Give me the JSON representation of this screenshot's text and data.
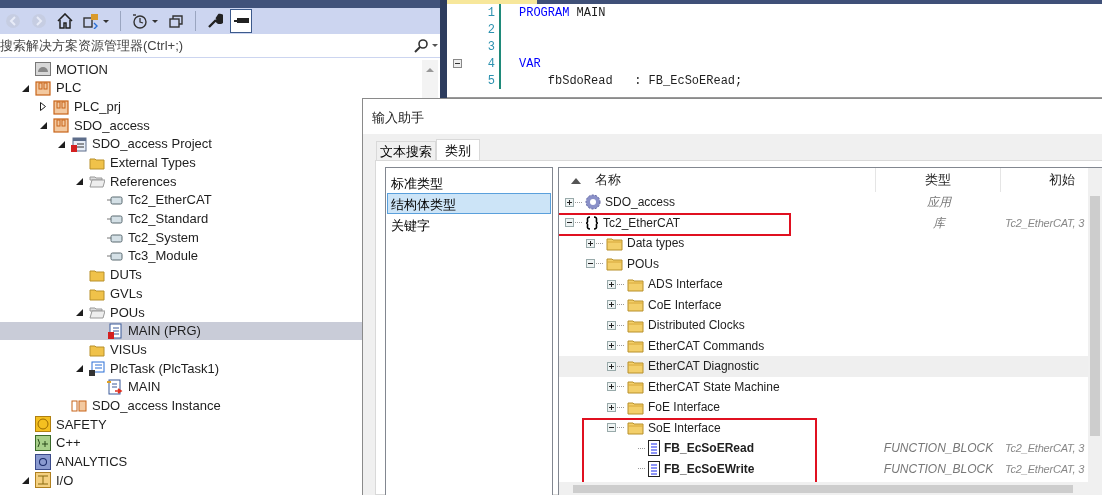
{
  "solution_explorer": {
    "toolbar": [
      {
        "kind": "back",
        "disabled": true
      },
      {
        "kind": "forward",
        "disabled": true
      },
      {
        "kind": "home",
        "disabled": false
      },
      {
        "kind": "sync",
        "disabled": false
      },
      {
        "kind": "history",
        "disabled": false
      },
      {
        "kind": "windows",
        "disabled": false
      },
      {
        "kind": "wrench",
        "disabled": false
      },
      {
        "kind": "pin",
        "disabled": false
      }
    ],
    "search": {
      "placeholder": "搜索解决方案资源管理器(Ctrl+;)"
    },
    "tree": [
      {
        "label": "MOTION",
        "kind": "motion",
        "selected": false
      },
      {
        "label": "PLC",
        "kind": "plc",
        "expanded": true,
        "selected": false,
        "children": [
          {
            "label": "PLC_prj",
            "kind": "plc",
            "expanded": false,
            "selected": false
          },
          {
            "label": "SDO_access",
            "kind": "plc",
            "expanded": true,
            "selected": false,
            "children": [
              {
                "label": "SDO_access Project",
                "kind": "project",
                "expanded": true,
                "selected": false,
                "children": [
                  {
                    "label": "External Types",
                    "kind": "folder",
                    "selected": false
                  },
                  {
                    "label": "References",
                    "kind": "references",
                    "expanded": true,
                    "selected": false,
                    "children": [
                      {
                        "label": "Tc2_EtherCAT",
                        "kind": "reference",
                        "selected": false
                      },
                      {
                        "label": "Tc2_Standard",
                        "kind": "reference",
                        "selected": false
                      },
                      {
                        "label": "Tc2_System",
                        "kind": "reference",
                        "selected": false
                      },
                      {
                        "label": "Tc3_Module",
                        "kind": "reference",
                        "selected": false
                      }
                    ]
                  },
                  {
                    "label": "DUTs",
                    "kind": "folder",
                    "selected": false
                  },
                  {
                    "label": "GVLs",
                    "kind": "folder",
                    "selected": false
                  },
                  {
                    "label": "POUs",
                    "kind": "references",
                    "expanded": true,
                    "selected": false,
                    "children": [
                      {
                        "label": "MAIN (PRG)",
                        "kind": "program",
                        "selected": true
                      }
                    ]
                  },
                  {
                    "label": "VISUs",
                    "kind": "folder",
                    "selected": false
                  },
                  {
                    "label": "PlcTask (PlcTask1)",
                    "kind": "task",
                    "expanded": true,
                    "selected": false,
                    "children": [
                      {
                        "label": "MAIN",
                        "kind": "call",
                        "selected": false
                      }
                    ]
                  }
                ]
              },
              {
                "label": "SDO_access Instance",
                "kind": "instance",
                "selected": false
              }
            ]
          }
        ]
      },
      {
        "label": "SAFETY",
        "kind": "safety",
        "selected": false
      },
      {
        "label": "C++",
        "kind": "cpp",
        "selected": false
      },
      {
        "label": "ANALYTICS",
        "kind": "analytics",
        "selected": false
      },
      {
        "label": "I/O",
        "kind": "io",
        "expanded": true,
        "selected": false
      }
    ]
  },
  "editor": {
    "lines": [
      {
        "number": "1",
        "fold": false,
        "segments": [
          {
            "text": "PROGRAM",
            "kind": "keyword"
          },
          {
            "text": " MAIN",
            "kind": "plain"
          }
        ]
      },
      {
        "number": "2",
        "fold": false
      },
      {
        "number": "3",
        "fold": false
      },
      {
        "number": "4",
        "fold": true,
        "segments": [
          {
            "text": "VAR",
            "kind": "keyword"
          }
        ]
      },
      {
        "number": "5",
        "fold": false,
        "segments": [
          {
            "text": "    fbSdoRead   : FB_EcSoERead;",
            "kind": "plain"
          }
        ]
      }
    ]
  },
  "dialog": {
    "title": "输入助手",
    "tabs": [
      {
        "label": "文本搜索",
        "selected": false
      },
      {
        "label": "类别",
        "selected": true
      }
    ],
    "categories": [
      {
        "label": "标准类型",
        "selected": false
      },
      {
        "label": "结构体类型",
        "selected": true
      },
      {
        "label": "关键字",
        "selected": false
      }
    ],
    "columns": [
      "名称",
      "类型",
      "初始"
    ],
    "tree": [
      {
        "name": "SDO_access",
        "kind": "application",
        "expanded": false,
        "hovered": false,
        "type": "应用"
      },
      {
        "name": "Tc2_EtherCAT",
        "kind": "library",
        "expanded": true,
        "hovered": false,
        "type": "库",
        "init": "Tc2_EtherCAT, 3",
        "framed": true,
        "children": [
          {
            "name": "Data types",
            "kind": "folder",
            "expanded": false,
            "hovered": false
          },
          {
            "name": "POUs",
            "kind": "folder",
            "expanded": true,
            "hovered": false,
            "children": [
              {
                "name": "ADS Interface",
                "kind": "folder",
                "expanded": false,
                "hovered": false
              },
              {
                "name": "CoE Interface",
                "kind": "folder",
                "expanded": false,
                "hovered": false
              },
              {
                "name": "Distributed Clocks",
                "kind": "folder",
                "expanded": false,
                "hovered": false
              },
              {
                "name": "EtherCAT Commands",
                "kind": "folder",
                "expanded": false,
                "hovered": false
              },
              {
                "name": "EtherCAT Diagnostic",
                "kind": "folder",
                "expanded": false,
                "hovered": true
              },
              {
                "name": "EtherCAT State Machine",
                "kind": "folder",
                "expanded": false,
                "hovered": false
              },
              {
                "name": "FoE Interface",
                "kind": "folder",
                "expanded": false,
                "hovered": false
              },
              {
                "name": "SoE Interface",
                "kind": "folder",
                "expanded": true,
                "hovered": false,
                "framed": true,
                "frame_covers_children": true,
                "children": [
                  {
                    "name": "FB_EcSoERead",
                    "kind": "function-block",
                    "hovered": false,
                    "type": "FUNCTION_BLOCK",
                    "init": "Tc2_EtherCAT, 3"
                  },
                  {
                    "name": "FB_EcSoEWrite",
                    "kind": "function-block",
                    "hovered": false,
                    "type": "FUNCTION_BLOCK",
                    "init": "Tc2_EtherCAT, 3"
                  }
                ]
              }
            ]
          }
        ]
      }
    ]
  }
}
